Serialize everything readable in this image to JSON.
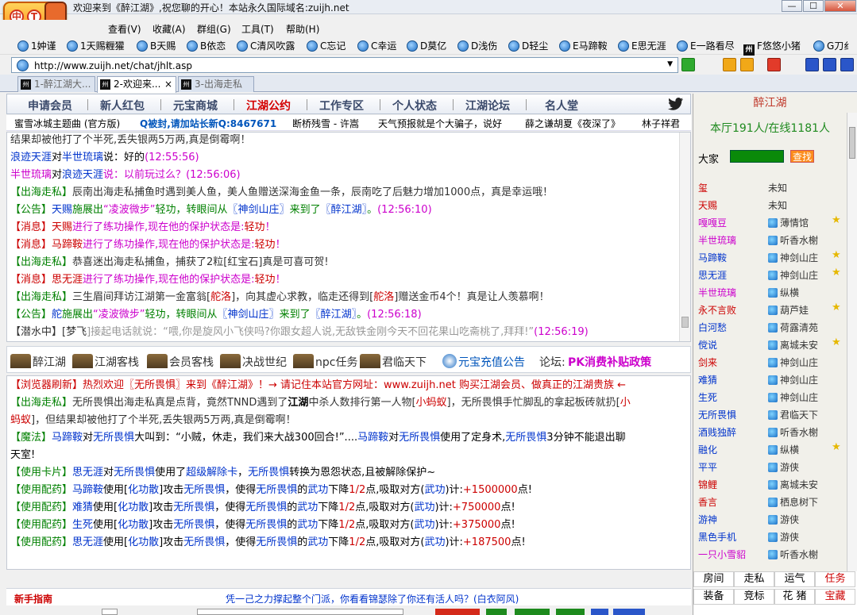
{
  "window_title": "欢迎来到《醉江湖》,祝您聊的开心！本站永久国际域名:zuijh.net",
  "window_controls": [
    "—",
    "☐",
    "✕"
  ],
  "logo_text": [
    "中",
    "T"
  ],
  "menu": [
    "查看(V)",
    "收藏(A)",
    "群组(G)",
    "工具(T)",
    "帮助(H)"
  ],
  "favorites": [
    "1妕谨",
    "1天赐糎獾",
    "B天赐",
    "B依恋",
    "C清风吹露",
    "C忘记",
    "C幸运",
    "D莫亿",
    "D浅伤",
    "D轻尘",
    "E马蹄鞍",
    "E思无涯",
    "E一路看尽",
    "F悠悠小猪",
    "G刀纟"
  ],
  "address": {
    "url": "http://www.zuijh.net/chat/jhlt.asp"
  },
  "tabs": [
    {
      "label": "1-醉江湖大..."
    },
    {
      "label": "2-欢迎来...",
      "close": "×"
    },
    {
      "label": "3-出海走私"
    }
  ],
  "nav": [
    "申请会员",
    "新人红包",
    "元宝商城",
    "江湖公约",
    "工作专区",
    "个人状态",
    "江湖论坛",
    "名人堂"
  ],
  "ticker": [
    {
      "t": "蜜雪冰城主题曲 (官方版)",
      "c": "#333"
    },
    {
      "t": "Q被封,请加站长新Q:8467671",
      "c": "#0055bb",
      "b": true
    },
    {
      "t": "断桥残雪 - 许嵩",
      "c": "#333"
    },
    {
      "t": "天气预报就是个大骗子，说好",
      "c": "#333"
    },
    {
      "t": "薛之谦胡夏《夜深了》",
      "c": "#333"
    },
    {
      "t": "林子祥君",
      "c": "#333"
    }
  ],
  "chat_top": [
    {
      "segs": [
        {
          "t": "结果却被他打了个半死,丢失银两5万两,真是倒霉啊！",
          "c": "#333"
        }
      ]
    },
    {
      "segs": [
        {
          "t": "浪迹天涯",
          "c": "#0033cc"
        },
        {
          "t": "对",
          "c": "#000"
        },
        {
          "t": "半世琉璃",
          "c": "#0033cc"
        },
        {
          "t": "说：好的",
          "c": "#000"
        },
        {
          "t": "(12:55:56)",
          "c": "#cc00cc"
        }
      ]
    },
    {
      "segs": [
        {
          "t": "半世琉璃",
          "c": "#cc00cc"
        },
        {
          "t": "对",
          "c": "#000"
        },
        {
          "t": "浪迹天涯",
          "c": "#0033cc"
        },
        {
          "t": "说：以前玩过么？",
          "c": "#cc00cc"
        },
        {
          "t": "(12:56:06)",
          "c": "#cc00cc"
        }
      ]
    },
    {
      "segs": [
        {
          "t": "【出海走私】",
          "c": "#008000"
        },
        {
          "t": "辰南出海走私捕鱼时遇到美人鱼，美人鱼赠送深海金鱼一条，辰南吃了后魅力增加1000点，真是幸运哦！",
          "c": "#333"
        }
      ]
    },
    {
      "segs": [
        {
          "t": "【公告】",
          "c": "#008000"
        },
        {
          "t": "天赐",
          "c": "#0033cc"
        },
        {
          "t": "施展出",
          "c": "#008000"
        },
        {
          "t": "“凌波微步”",
          "c": "#cc00cc"
        },
        {
          "t": "轻功，转眼间从",
          "c": "#008000"
        },
        {
          "t": "〖神剑山庄〗",
          "c": "#0033cc"
        },
        {
          "t": "来到了",
          "c": "#008000"
        },
        {
          "t": "〖醉江湖〗",
          "c": "#0033cc"
        },
        {
          "t": "。",
          "c": "#008000"
        },
        {
          "t": "(12:56:10)",
          "c": "#cc00cc"
        }
      ]
    },
    {
      "segs": [
        {
          "t": "【消息】",
          "c": "#cc0000"
        },
        {
          "t": "天赐",
          "c": "#cc0000"
        },
        {
          "t": "进行了练功操作,现在他的保护状态是:",
          "c": "#cc00cc"
        },
        {
          "t": "轻功",
          "c": "#cc0000"
        },
        {
          "t": "！",
          "c": "#cc00cc"
        }
      ]
    },
    {
      "segs": [
        {
          "t": "【消息】",
          "c": "#cc0000"
        },
        {
          "t": "马蹄鞍",
          "c": "#cc0000"
        },
        {
          "t": "进行了练功操作,现在他的保护状态是:",
          "c": "#cc00cc"
        },
        {
          "t": "轻功",
          "c": "#cc0000"
        },
        {
          "t": "！",
          "c": "#cc00cc"
        }
      ]
    },
    {
      "segs": [
        {
          "t": "【出海走私】",
          "c": "#008000"
        },
        {
          "t": "恭喜迷出海走私捕鱼，捕获了2粒[红宝石]真是可喜可贺!",
          "c": "#333"
        }
      ]
    },
    {
      "segs": [
        {
          "t": "【消息】",
          "c": "#cc0000"
        },
        {
          "t": "思无涯",
          "c": "#cc0000"
        },
        {
          "t": "进行了练功操作,现在他的保护状态是:",
          "c": "#cc00cc"
        },
        {
          "t": "轻功",
          "c": "#cc0000"
        },
        {
          "t": "！",
          "c": "#cc00cc"
        }
      ]
    },
    {
      "segs": [
        {
          "t": "【出海走私】",
          "c": "#008000"
        },
        {
          "t": "三生眉间拜访江湖第一金富翁[",
          "c": "#333"
        },
        {
          "t": "舵洛",
          "c": "#cc0000"
        },
        {
          "t": "]，向其虚心求教，临走还得到[",
          "c": "#333"
        },
        {
          "t": "舵洛",
          "c": "#cc0000"
        },
        {
          "t": "]赠送金币4个！真是让人羡慕啊！",
          "c": "#333"
        }
      ]
    },
    {
      "segs": [
        {
          "t": "【公告】",
          "c": "#008000"
        },
        {
          "t": "舵",
          "c": "#0033cc"
        },
        {
          "t": "施展出",
          "c": "#008000"
        },
        {
          "t": "“凌波微步”",
          "c": "#cc00cc"
        },
        {
          "t": "轻功，转眼间从",
          "c": "#008000"
        },
        {
          "t": "〖神剑山庄〗",
          "c": "#0033cc"
        },
        {
          "t": "来到了",
          "c": "#008000"
        },
        {
          "t": "〖醉江湖〗",
          "c": "#0033cc"
        },
        {
          "t": "。",
          "c": "#008000"
        },
        {
          "t": "(12:56:18)",
          "c": "#cc00cc"
        }
      ]
    },
    {
      "segs": [
        {
          "t": "【潜水中】",
          "c": "#333"
        },
        {
          "t": "[",
          "c": "#333"
        },
        {
          "t": "梦飞",
          "c": "#333"
        },
        {
          "t": "]接起电话就说：“喂,你是旋风小飞侠吗?你跟女超人说,无敌铁金刚今天不回花果山吃斋桃了,拜拜!”",
          "c": "#999"
        },
        {
          "t": "(12:56:19)",
          "c": "#cc00cc"
        }
      ]
    }
  ],
  "rooms": [
    "醉江湖",
    "江湖客栈",
    "会员客栈",
    "决战世纪",
    "npc任务",
    "君临天下",
    "元宝充值公告"
  ],
  "forum_label": "论坛:",
  "forum_link": "PK消费补贴政策",
  "chat_bottom": [
    {
      "segs": [
        {
          "t": "【浏览器刷新】热烈欢迎〖无所畏惧〗来到《醉江湖》！→ 请记住本站官方网址：www.zuijh.net 购买江湖会员、做真正的江湖贵族 ←",
          "c": "#cc0000"
        }
      ]
    },
    {
      "segs": [
        {
          "t": "【出海走私】",
          "c": "#008000"
        },
        {
          "t": "无所畏惧出海走私真是点背，竟然TNND遇到了",
          "c": "#333"
        },
        {
          "t": "江湖",
          "c": "#000",
          "b": true
        },
        {
          "t": "中杀人数排行第一人物[",
          "c": "#333"
        },
        {
          "t": "小蚂蚁",
          "c": "#cc0000"
        },
        {
          "t": "]，无所畏惧手忙脚乱的拿起板砖就扔[",
          "c": "#333"
        },
        {
          "t": "小",
          "c": "#cc0000"
        }
      ]
    },
    {
      "segs": [
        {
          "t": "蚂蚁",
          "c": "#cc0000"
        },
        {
          "t": "]，但结果却被他打了个半死,丢失银两5万两,真是倒霉啊！",
          "c": "#333"
        }
      ]
    },
    {
      "segs": [
        {
          "t": "【魔法】",
          "c": "#008000"
        },
        {
          "t": "马蹄鞍",
          "c": "#0033cc"
        },
        {
          "t": "对",
          "c": "#000"
        },
        {
          "t": "无所畏惧",
          "c": "#0033cc"
        },
        {
          "t": "大叫到：“小贼，休走，我们来大战300回合!”....",
          "c": "#000"
        },
        {
          "t": "马蹄鞍",
          "c": "#0033cc"
        },
        {
          "t": "对",
          "c": "#000"
        },
        {
          "t": "无所畏惧",
          "c": "#0033cc"
        },
        {
          "t": "使用了定身术,",
          "c": "#000"
        },
        {
          "t": "无所畏惧",
          "c": "#0033cc"
        },
        {
          "t": "3分钟不能退出聊",
          "c": "#000"
        }
      ]
    },
    {
      "segs": [
        {
          "t": "天室!",
          "c": "#000"
        }
      ]
    },
    {
      "segs": [
        {
          "t": "【使用卡片】",
          "c": "#008000"
        },
        {
          "t": "思无涯",
          "c": "#0033cc"
        },
        {
          "t": "对",
          "c": "#000"
        },
        {
          "t": "无所畏惧",
          "c": "#0033cc"
        },
        {
          "t": "使用了",
          "c": "#000"
        },
        {
          "t": "超级解除卡",
          "c": "#0033cc"
        },
        {
          "t": "，",
          "c": "#000"
        },
        {
          "t": "无所畏惧",
          "c": "#0033cc"
        },
        {
          "t": "转换为恩怨状态,且被解除保护~",
          "c": "#000"
        }
      ]
    },
    {
      "segs": [
        {
          "t": "【使用配药】",
          "c": "#008000"
        },
        {
          "t": "马蹄鞍",
          "c": "#0033cc"
        },
        {
          "t": "使用[",
          "c": "#000"
        },
        {
          "t": "化功散",
          "c": "#0033cc"
        },
        {
          "t": "]攻击",
          "c": "#000"
        },
        {
          "t": "无所畏惧",
          "c": "#0033cc"
        },
        {
          "t": "，使得",
          "c": "#000"
        },
        {
          "t": "无所畏惧",
          "c": "#0033cc"
        },
        {
          "t": "的",
          "c": "#000"
        },
        {
          "t": "武功",
          "c": "#0033cc"
        },
        {
          "t": "下降",
          "c": "#000"
        },
        {
          "t": "1/2",
          "c": "#cc0000"
        },
        {
          "t": "点,吸取对方(",
          "c": "#000"
        },
        {
          "t": "武功",
          "c": "#0033cc"
        },
        {
          "t": ")计:",
          "c": "#000"
        },
        {
          "t": "+1500000",
          "c": "#cc0000"
        },
        {
          "t": "点!",
          "c": "#000"
        }
      ]
    },
    {
      "segs": [
        {
          "t": "【使用配药】",
          "c": "#008000"
        },
        {
          "t": "难猜",
          "c": "#0033cc"
        },
        {
          "t": "使用[",
          "c": "#000"
        },
        {
          "t": "化功散",
          "c": "#0033cc"
        },
        {
          "t": "]攻击",
          "c": "#000"
        },
        {
          "t": "无所畏惧",
          "c": "#0033cc"
        },
        {
          "t": "，使得",
          "c": "#000"
        },
        {
          "t": "无所畏惧",
          "c": "#0033cc"
        },
        {
          "t": "的",
          "c": "#000"
        },
        {
          "t": "武功",
          "c": "#0033cc"
        },
        {
          "t": "下降",
          "c": "#000"
        },
        {
          "t": "1/2",
          "c": "#cc0000"
        },
        {
          "t": "点,吸取对方(",
          "c": "#000"
        },
        {
          "t": "武功",
          "c": "#0033cc"
        },
        {
          "t": ")计:",
          "c": "#000"
        },
        {
          "t": "+750000",
          "c": "#cc0000"
        },
        {
          "t": "点!",
          "c": "#000"
        }
      ]
    },
    {
      "segs": [
        {
          "t": "【使用配药】",
          "c": "#008000"
        },
        {
          "t": "生死",
          "c": "#0033cc"
        },
        {
          "t": "使用[",
          "c": "#000"
        },
        {
          "t": "化功散",
          "c": "#0033cc"
        },
        {
          "t": "]攻击",
          "c": "#000"
        },
        {
          "t": "无所畏惧",
          "c": "#0033cc"
        },
        {
          "t": "，使得",
          "c": "#000"
        },
        {
          "t": "无所畏惧",
          "c": "#0033cc"
        },
        {
          "t": "的",
          "c": "#000"
        },
        {
          "t": "武功",
          "c": "#0033cc"
        },
        {
          "t": "下降",
          "c": "#000"
        },
        {
          "t": "1/2",
          "c": "#cc0000"
        },
        {
          "t": "点,吸取对方(",
          "c": "#000"
        },
        {
          "t": "武功",
          "c": "#0033cc"
        },
        {
          "t": ")计:",
          "c": "#000"
        },
        {
          "t": "+375000",
          "c": "#cc0000"
        },
        {
          "t": "点!",
          "c": "#000"
        }
      ]
    },
    {
      "segs": [
        {
          "t": "【使用配药】",
          "c": "#008000"
        },
        {
          "t": "思无涯",
          "c": "#0033cc"
        },
        {
          "t": "使用[",
          "c": "#000"
        },
        {
          "t": "化功散",
          "c": "#0033cc"
        },
        {
          "t": "]攻击",
          "c": "#000"
        },
        {
          "t": "无所畏惧",
          "c": "#0033cc"
        },
        {
          "t": "，使得",
          "c": "#000"
        },
        {
          "t": "无所畏惧",
          "c": "#0033cc"
        },
        {
          "t": "的",
          "c": "#000"
        },
        {
          "t": "武功",
          "c": "#0033cc"
        },
        {
          "t": "下降",
          "c": "#000"
        },
        {
          "t": "1/2",
          "c": "#cc0000"
        },
        {
          "t": "点,吸取对方(",
          "c": "#000"
        },
        {
          "t": "武功",
          "c": "#0033cc"
        },
        {
          "t": ")计:",
          "c": "#000"
        },
        {
          "t": "+187500",
          "c": "#cc0000"
        },
        {
          "t": "点!",
          "c": "#000"
        }
      ]
    }
  ],
  "bottom": {
    "guide": "新手指南",
    "slogan": "凭一己之力撑起整个门派，你看看锦瑟除了你还有活人吗？(白衣阿风)"
  },
  "right_panel": {
    "title": "醉江湖",
    "stats": "本厅191人/在线1181人",
    "dajia": "大家",
    "search_btn": "查找",
    "users": [
      {
        "name": "玺",
        "loc": "未知",
        "c": "#cc0000",
        "icon": false,
        "star": false
      },
      {
        "name": "天赐",
        "loc": "未知",
        "c": "#cc0000",
        "icon": false,
        "star": false
      },
      {
        "name": "嘎嘎豆",
        "loc": "薄情馆",
        "c": "#cc00cc",
        "icon": true,
        "star": true
      },
      {
        "name": "半世琉璃",
        "loc": "听香水榭",
        "c": "#cc00cc",
        "icon": true,
        "star": false
      },
      {
        "name": "马蹄鞍",
        "loc": "神剑山庄",
        "c": "#0033cc",
        "icon": true,
        "star": true
      },
      {
        "name": "思无涯",
        "loc": "神剑山庄",
        "c": "#0033cc",
        "icon": true,
        "star": true
      },
      {
        "name": "半世琉璃",
        "loc": "纵横",
        "c": "#cc00cc",
        "icon": true,
        "star": false
      },
      {
        "name": "永不言败",
        "loc": "葫芦娃",
        "c": "#cc0000",
        "icon": true,
        "star": true
      },
      {
        "name": "白河愁",
        "loc": "荷露清苑",
        "c": "#0033cc",
        "icon": true,
        "star": false
      },
      {
        "name": "傥说",
        "loc": "离城未安",
        "c": "#0033cc",
        "icon": true,
        "star": true
      },
      {
        "name": "剑来",
        "loc": "神剑山庄",
        "c": "#cc0000",
        "icon": true,
        "star": false
      },
      {
        "name": "难猜",
        "loc": "神剑山庄",
        "c": "#0033cc",
        "icon": true,
        "star": false
      },
      {
        "name": "生死",
        "loc": "神剑山庄",
        "c": "#0033cc",
        "icon": true,
        "star": false
      },
      {
        "name": "无所畏惧",
        "loc": "君临天下",
        "c": "#0033cc",
        "icon": true,
        "star": false
      },
      {
        "name": "酒贱独醉",
        "loc": "听香水榭",
        "c": "#0033cc",
        "icon": true,
        "star": false
      },
      {
        "name": "融化",
        "loc": "纵横",
        "c": "#0033cc",
        "icon": true,
        "star": true
      },
      {
        "name": "平平",
        "loc": "游侠",
        "c": "#0033cc",
        "icon": true,
        "star": false
      },
      {
        "name": "锦鲤",
        "loc": "离城未安",
        "c": "#cc0000",
        "icon": true,
        "star": false
      },
      {
        "name": "香言",
        "loc": "栖息树下",
        "c": "#cc0000",
        "icon": true,
        "star": false
      },
      {
        "name": "游神",
        "loc": "游侠",
        "c": "#0033cc",
        "icon": true,
        "star": false
      },
      {
        "name": "黑色手机",
        "loc": "游侠",
        "c": "#0033cc",
        "icon": true,
        "star": false
      },
      {
        "name": "一只小雪貂",
        "loc": "听香水榭",
        "c": "#cc00cc",
        "icon": true,
        "star": false
      }
    ],
    "grid": [
      [
        {
          "t": "房间",
          "c": "#000"
        },
        {
          "t": "走私",
          "c": "#000"
        },
        {
          "t": "运气",
          "c": "#000"
        },
        {
          "t": "任务",
          "c": "#cc0000"
        }
      ],
      [
        {
          "t": "装备",
          "c": "#000"
        },
        {
          "t": "竞标",
          "c": "#000"
        },
        {
          "t": "花 猪",
          "c": "#000"
        },
        {
          "t": "宝藏",
          "c": "#cc0000"
        }
      ]
    ]
  }
}
